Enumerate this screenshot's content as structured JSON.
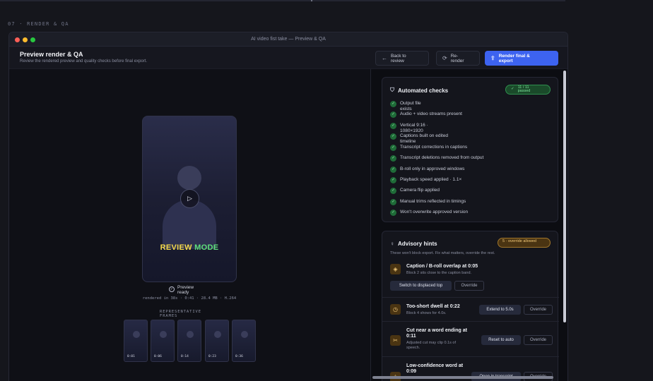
{
  "section_label": "07 · RENDER & QA",
  "window": {
    "title": "AI video fist take — Preview & QA"
  },
  "header": {
    "title": "Preview render & QA",
    "subtitle": "Review the rendered preview and quality checks before final export.",
    "back_label": "Back to review",
    "rerender_label": "Re-render",
    "render_label": "Render final & export"
  },
  "preview": {
    "overlay_word1": "REVIEW",
    "overlay_word2": "MODE",
    "ready_label": "Preview ready",
    "meta": "rendered in 38s · 0:41 · 28.4 MB · H.264",
    "frames_label": "REPRESENTATIVE FRAMES",
    "frames": [
      {
        "time": "0:01"
      },
      {
        "time": "0:06"
      },
      {
        "time": "0:14"
      },
      {
        "time": "0:23"
      },
      {
        "time": "0:36"
      }
    ]
  },
  "checks": {
    "title": "Automated checks",
    "badge": "11 / 11 passed",
    "items": [
      {
        "label": "Output file exists"
      },
      {
        "label": "Audio + video streams present"
      },
      {
        "label": "Vertical 9:16 · 1080×1920"
      },
      {
        "label": "Captions built on edited timeline"
      },
      {
        "label": "Transcript corrections in captions"
      },
      {
        "label": "Transcript deletions removed from output"
      },
      {
        "label": "B-roll only in approved windows"
      },
      {
        "label": "Playback speed applied · 1.1×"
      },
      {
        "label": "Camera flip applied"
      },
      {
        "label": "Manual trims reflected in timings"
      },
      {
        "label": "Won't overwrite approved version"
      }
    ]
  },
  "hints": {
    "title": "Advisory hints",
    "badge": "5 · override allowed",
    "subtitle": "These won't block export. Fix what matters, override the rest.",
    "items": [
      {
        "title": "Caption / B-roll overlap at 0:05",
        "desc": "Block 2 sits close to the caption band.",
        "fix": "Switch to displaced top",
        "override": "Override"
      },
      {
        "title": "Too-short dwell at 0:22",
        "desc": "Block 4 shows for 4.0s.",
        "fix": "Extend to 5.0s",
        "override": "Override"
      },
      {
        "title": "Cut near a word ending at 0:11",
        "desc": "Adjusted cut may clip 0.1s of speech.",
        "fix": "Reset to auto",
        "override": "Override"
      },
      {
        "title": "Low-confidence word at 0:09",
        "desc": "",
        "fix": "Open in transcript",
        "override": "Override"
      }
    ]
  }
}
